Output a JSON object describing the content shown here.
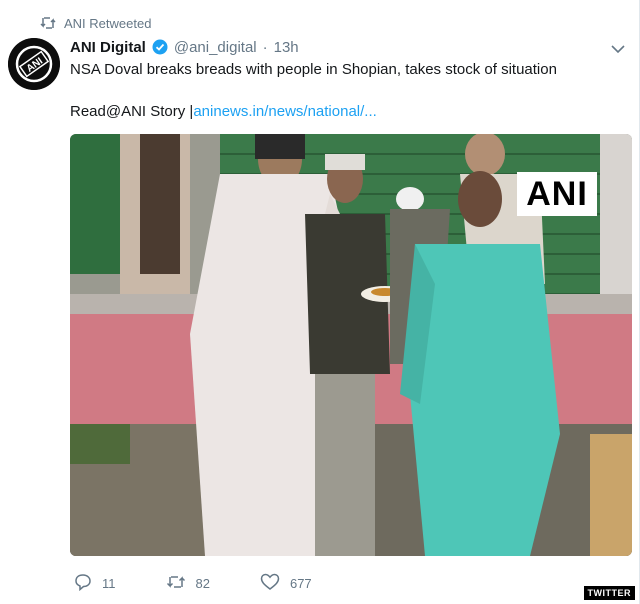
{
  "retweet": {
    "label": "ANI Retweeted"
  },
  "author": {
    "name": "ANI Digital",
    "handle": "@ani_digital",
    "separator": "·",
    "time": "13h",
    "avatar_text": "ANI"
  },
  "tweet": {
    "text": "NSA Doval breaks breads with people in Shopian, takes stock of situation",
    "read_prefix": "Read@ANI Story |",
    "link": "aninews.in/news/national/..."
  },
  "media": {
    "watermark_text": "ANI"
  },
  "actions": {
    "replies": "11",
    "retweets": "82",
    "likes": "677"
  },
  "source_watermark": "TWITTER",
  "colors": {
    "link": "#1da1f2",
    "muted": "#657786",
    "verified": "#1da1f2"
  },
  "icons": [
    "retweet-icon",
    "verified-icon",
    "chevron-down-icon",
    "reply-icon",
    "like-icon"
  ]
}
